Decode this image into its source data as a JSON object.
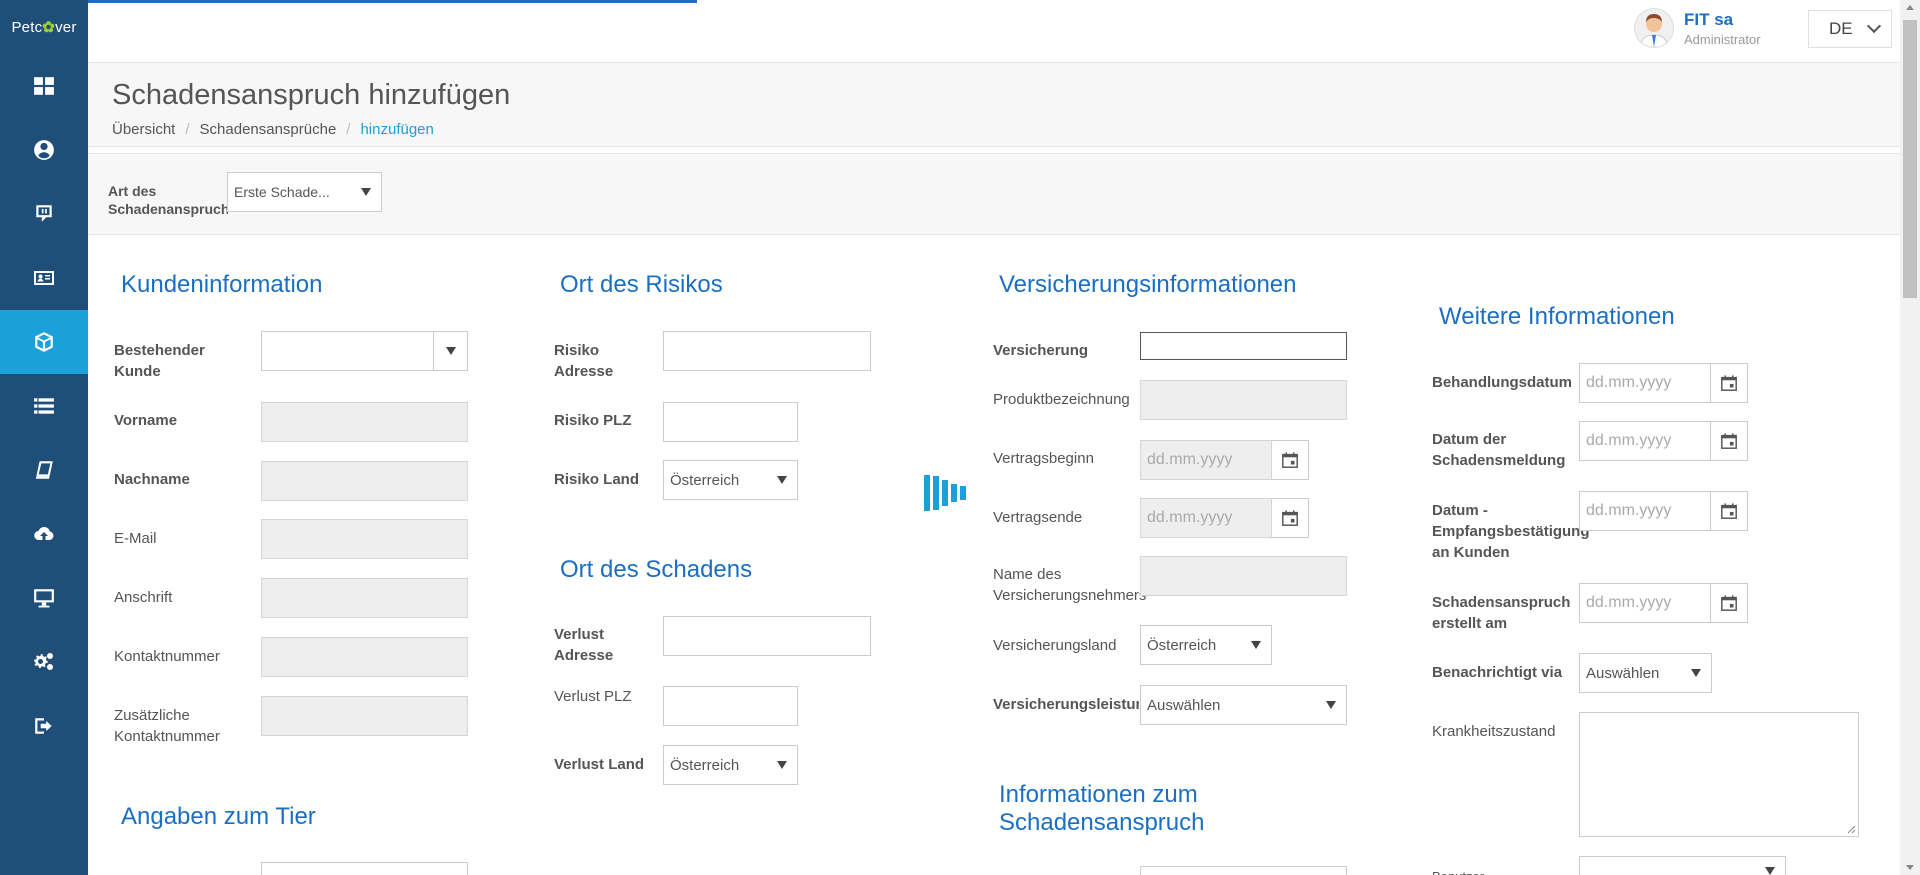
{
  "app": {
    "logo_text_1": "Petc",
    "logo_paw": "✿",
    "logo_text_2": "ver"
  },
  "sidebar": {
    "items": [
      {
        "icon": "dashboard-icon"
      },
      {
        "icon": "user-circle-icon"
      },
      {
        "icon": "chat-icon"
      },
      {
        "icon": "id-card-icon"
      },
      {
        "icon": "cube-icon",
        "active": true
      },
      {
        "icon": "list-icon"
      },
      {
        "icon": "book-icon"
      },
      {
        "icon": "cloud-upload-icon"
      },
      {
        "icon": "monitor-icon"
      },
      {
        "icon": "cogs-icon"
      },
      {
        "icon": "logout-icon"
      }
    ]
  },
  "user": {
    "name": "FIT sa",
    "role": "Administrator"
  },
  "language": {
    "value": "DE"
  },
  "header": {
    "title": "Schadensanspruch hinzufügen",
    "breadcrumb": [
      "Übersicht",
      "Schadensansprüche",
      "hinzufügen"
    ]
  },
  "claim_type": {
    "label": "Art des Schadenanspruchs",
    "value": "Erste Schade..."
  },
  "customer": {
    "title": "Kundeninformation",
    "existing_label": "Bestehender Kunde",
    "firstname_label": "Vorname",
    "lastname_label": "Nachname",
    "email_label": "E-Mail",
    "address_label": "Anschrift",
    "phone_label": "Kontaktnummer",
    "phone2_label": "Zusätzliche Kontaktnummer"
  },
  "animal": {
    "title": "Angaben zum Tier"
  },
  "risk": {
    "title": "Ort des Risikos",
    "address_label": "Risiko Adresse",
    "zip_label": "Risiko PLZ",
    "country_label": "Risiko Land",
    "country_value": "Österreich"
  },
  "damage": {
    "title": "Ort des Schadens",
    "address_label": "Verlust Adresse",
    "zip_label": "Verlust PLZ",
    "country_label": "Verlust Land",
    "country_value": "Österreich"
  },
  "insurance": {
    "title": "Versicherungsinformationen",
    "policy_label": "Versicherung",
    "product_label": "Produktbezeichnung",
    "start_label": "Vertragsbeginn",
    "start_placeholder": "dd.mm.yyyy",
    "end_label": "Vertragsende",
    "end_placeholder": "dd.mm.yyyy",
    "holder_label": "Name des Versicherungsnehmers",
    "country_label": "Versicherungsland",
    "country_value": "Österreich",
    "benefit_label": "Versicherungsleistung",
    "benefit_value": "Auswählen"
  },
  "claim_info": {
    "title": "Informationen zum Schadensanspruch"
  },
  "more": {
    "title": "Weitere Informationen",
    "treatment_label": "Behandlungsdatum",
    "report_label": "Datum der Schadensmeldung",
    "receipt_label": "Datum - Empfangsbestätigung an Kunden",
    "created_label": "Schadensanspruch erstellt am",
    "date_placeholder": "dd.mm.yyyy",
    "notified_label": "Benachrichtigt via",
    "notified_value": "Auswählen",
    "condition_label": "Krankheitszustand",
    "user_label": "Benutzer"
  }
}
